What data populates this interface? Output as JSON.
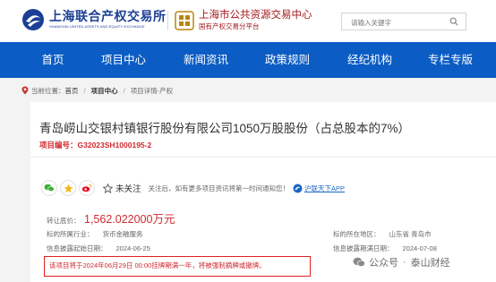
{
  "header": {
    "logo_sueae": {
      "name_cn": "上海联合产权交易所",
      "name_en": "SHANGHAI UNITED ASSETS AND EQUITY EXCHANGE"
    },
    "logo_public": {
      "name_cn": "上海市公共资源交易中心",
      "subtitle": "国有产权交易分平台"
    },
    "search": {
      "placeholder": "请输入关键字"
    }
  },
  "nav": {
    "items": [
      {
        "label": "首页"
      },
      {
        "label": "项目中心"
      },
      {
        "label": "新闻资讯"
      },
      {
        "label": "政策规则"
      },
      {
        "label": "经纪机构"
      },
      {
        "label": "专栏专版"
      }
    ]
  },
  "breadcrumb": {
    "prefix": "当前位置：",
    "items": [
      "首页",
      "项目中心",
      "项目详情-产权"
    ]
  },
  "project": {
    "title": "青岛崂山交银村镇银行股份有限公司1050万股股份（占总股本的7%）",
    "number_label": "项目编号：",
    "number": "G32023SH1000195-2",
    "follow_label": "未关注",
    "notify_text": "关注后，如有更多项目资讯将第一时间通知您！",
    "app_link": "沪联天下APP",
    "price_label": "转让底价：",
    "price_value": "1,562.022000万元",
    "industry_label": "标的所属行业：",
    "industry_value": "货币金融服务",
    "location_label": "标的所在地区：",
    "location_value": "山东省 青岛市",
    "start_label": "信息披露起始日期：",
    "start_value": "2024-06-25",
    "end_label": "信息披露期满日期：",
    "end_value": "2024-07-08",
    "notice": "该项目将于2024年06月29日 00:00挂牌期满一年，将被强制摘牌或撤牌。"
  },
  "share_icons": [
    "wechat-icon",
    "qzone-icon",
    "weibo-icon"
  ],
  "watermark": {
    "platform": "公众号",
    "account": "泰山财经"
  },
  "colors": {
    "nav_bg": "#0b5cc4",
    "brand_blue": "#1c3f95",
    "accent_red": "#d0292e",
    "notice_border": "#e02020",
    "page_bg": "#f3f3f3"
  }
}
